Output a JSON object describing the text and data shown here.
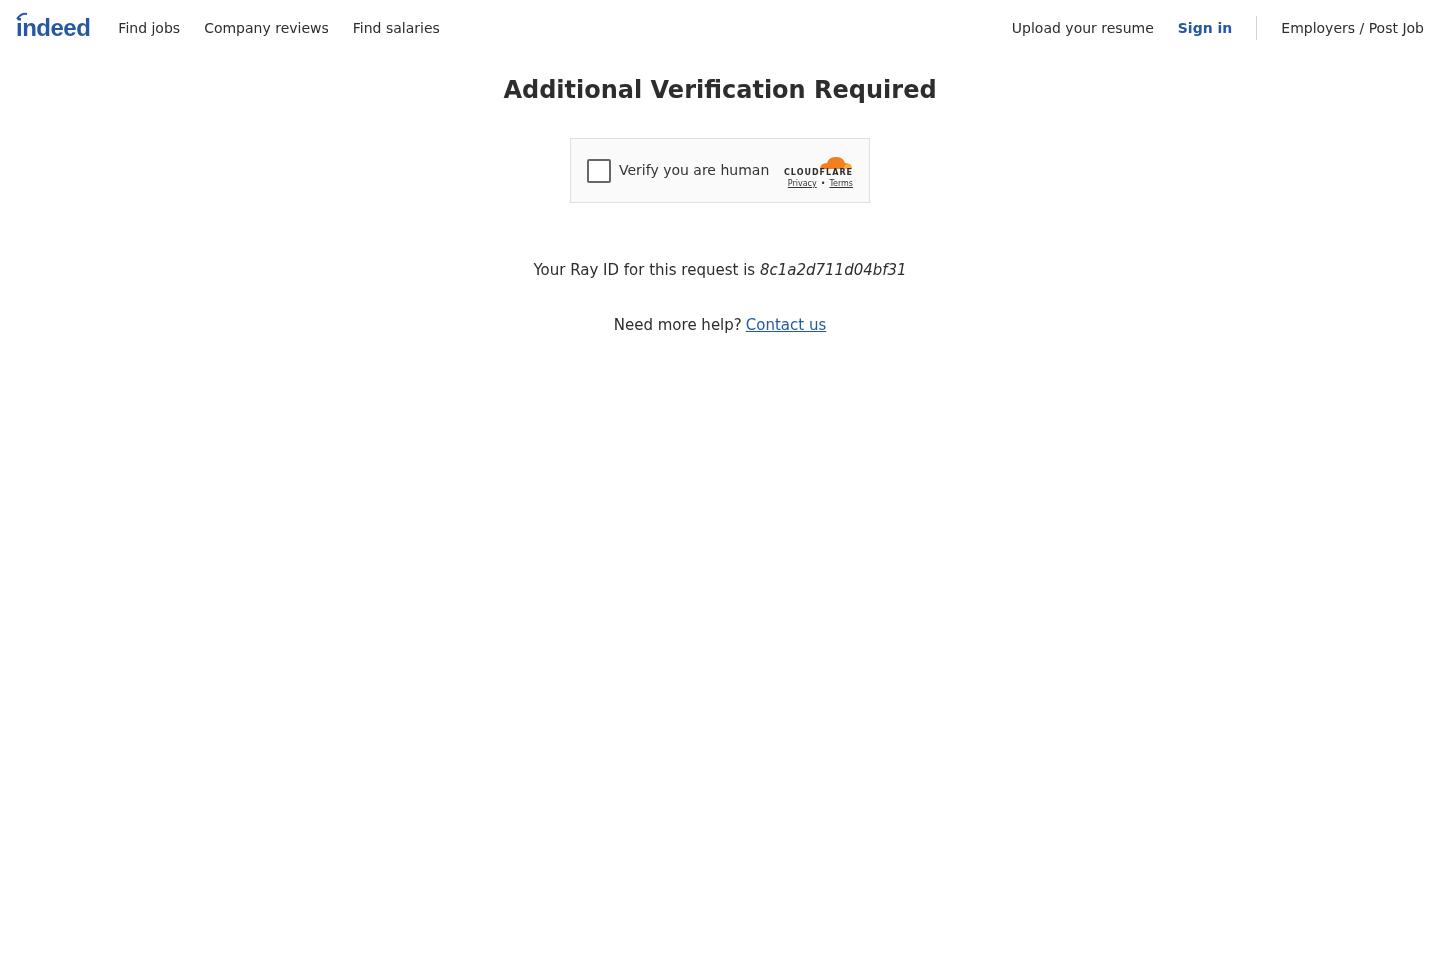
{
  "header": {
    "logo": "indeed",
    "nav": [
      {
        "label": "Find jobs"
      },
      {
        "label": "Company reviews"
      },
      {
        "label": "Find salaries"
      }
    ],
    "right_nav": [
      {
        "label": "Upload your resume",
        "kind": "plain"
      },
      {
        "label": "Sign in",
        "kind": "primary"
      },
      {
        "label": "Employers / Post Job",
        "kind": "separated"
      }
    ]
  },
  "title": "Additional Verification Required",
  "widget": {
    "label": "Verify you are human",
    "checked": false,
    "brand": "CLOUDFLARE",
    "links": [
      "Privacy",
      "Terms"
    ],
    "separator": "•"
  },
  "ray_id": "Your Ray ID for this request is *8c1a2d711d04bf31*",
  "help": {
    "text": "Need more help?",
    "link": "Contact us"
  }
}
